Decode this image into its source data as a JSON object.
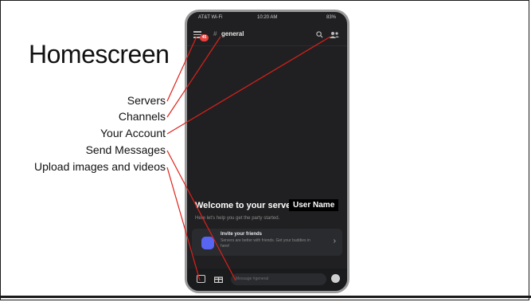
{
  "slide": {
    "title": "Homescreen",
    "labels": {
      "servers": "Servers",
      "channels": "Channels",
      "account": "Your Account",
      "send_messages": "Send Messages",
      "upload": "Upload images and videos"
    }
  },
  "phone": {
    "status": {
      "left": "AT&T Wi-Fi",
      "time": "10:20 AM",
      "right": "83%"
    },
    "header": {
      "badge": "45",
      "hash": "#",
      "channel": "general"
    },
    "welcome": {
      "heading": "Welcome to your server,",
      "user_name": "User Name",
      "subtitle": "Here let's help you get the party started."
    },
    "invite": {
      "title": "Invite your friends",
      "description": "Servers are better with friends. Get your buddies in here!",
      "chevron": "›"
    },
    "composer": {
      "placeholder": "Message #general"
    }
  },
  "colors": {
    "arrow": "#e0201a",
    "phone_bg": "#202022",
    "accent": "#5865f2"
  },
  "icons": [
    "menu-icon",
    "search-icon",
    "members-icon",
    "image-icon",
    "gift-icon",
    "emoji-icon"
  ]
}
